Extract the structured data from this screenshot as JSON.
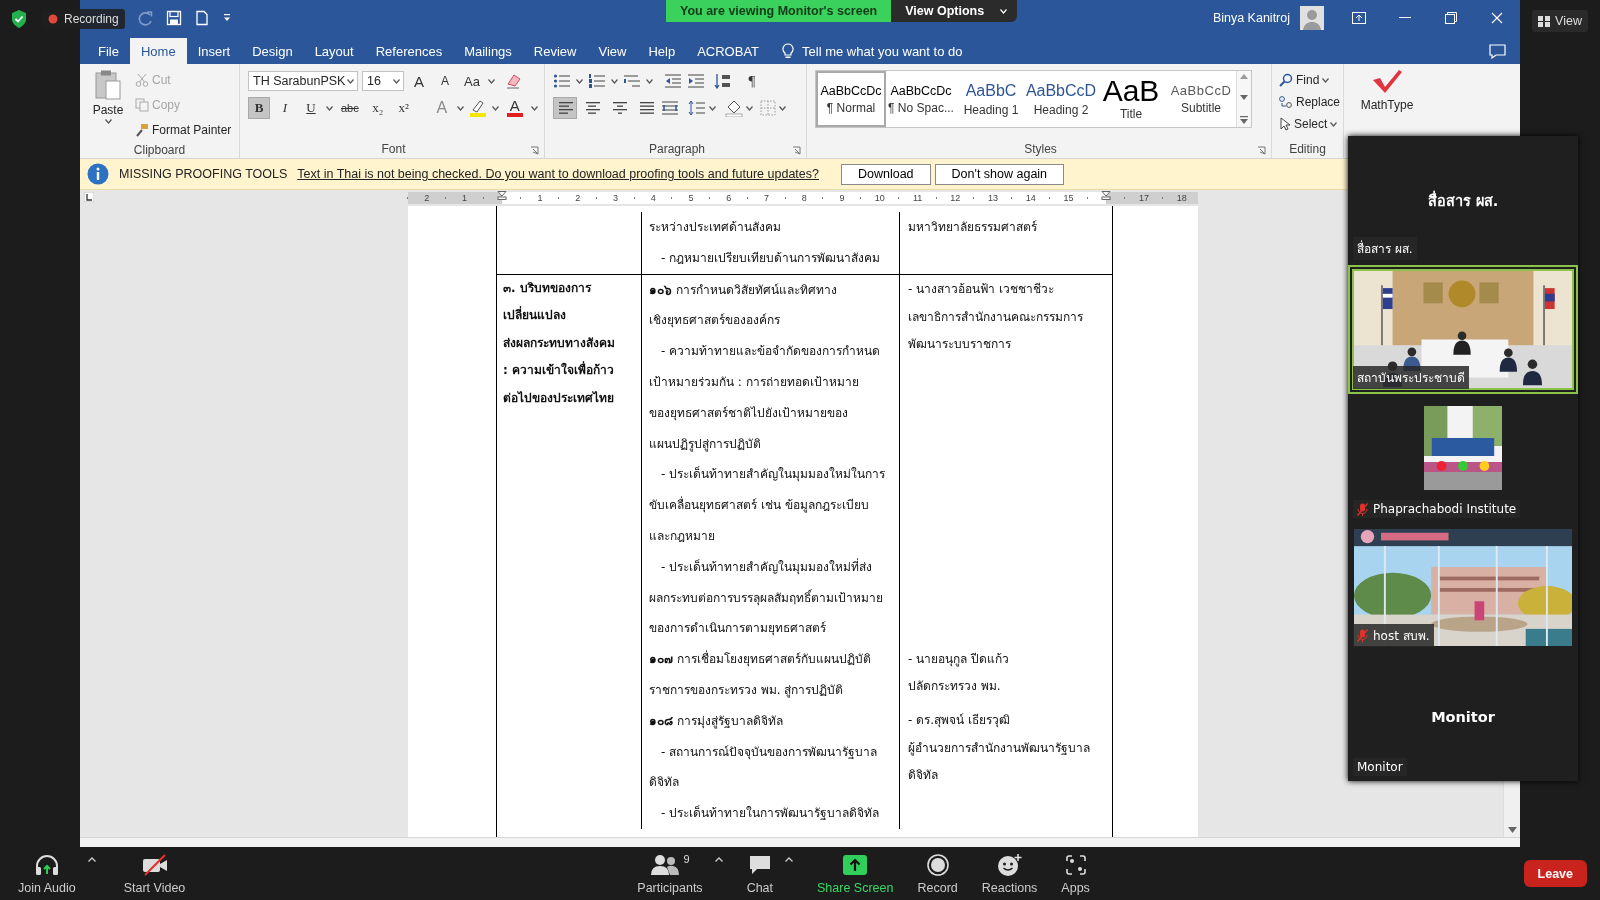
{
  "zoom_top": {
    "recording": "Recording",
    "view": "View"
  },
  "share_banner": {
    "text": "You are viewing Monitor's screen",
    "options": "View Options"
  },
  "word": {
    "user": "Binya Kanitroj",
    "tabs": [
      {
        "label": "File",
        "selected": false
      },
      {
        "label": "Home",
        "selected": true
      },
      {
        "label": "Insert",
        "selected": false
      },
      {
        "label": "Design",
        "selected": false
      },
      {
        "label": "Layout",
        "selected": false
      },
      {
        "label": "References",
        "selected": false
      },
      {
        "label": "Mailings",
        "selected": false
      },
      {
        "label": "Review",
        "selected": false
      },
      {
        "label": "View",
        "selected": false
      },
      {
        "label": "Help",
        "selected": false
      },
      {
        "label": "ACROBAT",
        "selected": false
      }
    ],
    "tell_me": "Tell me what you want to do",
    "ribbon": {
      "clipboard": {
        "label": "Clipboard",
        "paste": "Paste",
        "cut": "Cut",
        "copy": "Copy",
        "format_painter": "Format Painter"
      },
      "font": {
        "label": "Font",
        "name": "TH SarabunPSK",
        "size": "16",
        "tools": [
          {
            "kind": "grow",
            "glyph": "A"
          },
          {
            "kind": "shrink",
            "glyph": "A"
          },
          {
            "kind": "case",
            "glyph": "Aa"
          }
        ],
        "format_buttons": [
          {
            "kind": "bold",
            "glyph": "B",
            "pressed": true
          },
          {
            "kind": "italic",
            "glyph": "I",
            "pressed": false
          },
          {
            "kind": "underline",
            "glyph": "U",
            "pressed": false
          },
          {
            "kind": "strike",
            "glyph": "abc",
            "pressed": false
          },
          {
            "kind": "subscript",
            "glyph": "x₂",
            "pressed": false
          },
          {
            "kind": "superscript",
            "glyph": "x²",
            "pressed": false
          }
        ],
        "effects_glyph": "A",
        "color_glyph": "A"
      },
      "paragraph": {
        "label": "Paragraph",
        "marks_glyph": "¶",
        "align_buttons": [
          {
            "kind": "left",
            "pressed": true
          },
          {
            "kind": "center",
            "pressed": false
          },
          {
            "kind": "right",
            "pressed": false
          },
          {
            "kind": "justify",
            "pressed": false
          }
        ]
      },
      "styles": {
        "label": "Styles",
        "items": [
          {
            "kind": "normal",
            "preview": "AaBbCcDc",
            "name": "¶ Normal",
            "selected": true
          },
          {
            "kind": "normal",
            "preview": "AaBbCcDc",
            "name": "¶ No Spac...",
            "selected": false
          },
          {
            "kind": "heading",
            "preview": "AaBbC",
            "name": "Heading 1",
            "selected": false
          },
          {
            "kind": "heading",
            "preview": "AaBbCcD",
            "name": "Heading 2",
            "selected": false
          },
          {
            "kind": "title",
            "preview": "AaB",
            "name": "Title",
            "selected": false
          },
          {
            "kind": "subtitle",
            "preview": "AaBbCcD",
            "name": "Subtitle",
            "selected": false
          }
        ]
      },
      "editing": {
        "label": "Editing",
        "find": "Find",
        "replace": "Replace",
        "select": "Select"
      },
      "mathtype": "MathType"
    },
    "message_bar": {
      "title": "MISSING PROOFING TOOLS",
      "text": "Text in Thai is not being checked. Do you want to download proofing tools and future updates?",
      "buttons": [
        "Download",
        "Don't show again"
      ]
    },
    "ruler": [
      {
        "kind": "number",
        "label": "2"
      },
      {
        "kind": "number",
        "label": "1"
      },
      {
        "kind": "marker"
      },
      {
        "kind": "number",
        "label": "1"
      },
      {
        "kind": "number",
        "label": "2"
      },
      {
        "kind": "number",
        "label": "3"
      },
      {
        "kind": "number",
        "label": "4"
      },
      {
        "kind": "number",
        "label": "5"
      },
      {
        "kind": "number",
        "label": "6"
      },
      {
        "kind": "number",
        "label": "7"
      },
      {
        "kind": "number",
        "label": "8"
      },
      {
        "kind": "number",
        "label": "9"
      },
      {
        "kind": "number",
        "label": "10"
      },
      {
        "kind": "number",
        "label": "11"
      },
      {
        "kind": "number",
        "label": "12"
      },
      {
        "kind": "number",
        "label": "13"
      },
      {
        "kind": "number",
        "label": "14"
      },
      {
        "kind": "number",
        "label": "15"
      },
      {
        "kind": "marker"
      },
      {
        "kind": "number",
        "label": "17"
      },
      {
        "kind": "number",
        "label": "18"
      }
    ],
    "table": {
      "rows": [
        {
          "sections": [
            {
              "topics": [
                {
                  "indent": false,
                  "lines": [
                    "ระหว่างประเทศด้านสังคม"
                  ]
                },
                {
                  "indent": true,
                  "lines": [
                    "- กฎหมายเปรียบเทียบด้านการพัฒนาสังคม"
                  ]
                }
              ],
              "speakers": [
                {
                  "lines": [
                    "มหาวิทยาลัยธรรมศาสตร์"
                  ]
                }
              ]
            }
          ]
        },
        {
          "heading": [
            "๓. บริบทของการ",
            "เปลี่ยนแปลง",
            "ส่งผลกระทบทางสังคม",
            ": ความเข้าใจเพื่อก้าว",
            "ต่อไปของประเทศไทย"
          ],
          "sections": [
            {
              "topics": [
                {
                  "indent": false,
                  "lines": [
                    "**๑๐๖** การกำหนดวิสัยทัศน์และทิศทาง",
                    "เชิงยุทธศาสตร์ขององค์กร"
                  ]
                },
                {
                  "indent": true,
                  "lines": [
                    "- ความท้าทายและข้อจำกัดของการกำหนด",
                    "เป้าหมายร่วมกัน : การถ่ายทอดเป้าหมาย",
                    "ของยุทธศาสตร์ชาติไปยังเป้าหมายของ",
                    "แผนปฏิรูปสู่การปฏิบัติ"
                  ]
                },
                {
                  "indent": true,
                  "lines": [
                    "- ประเด็นท้าทายสำคัญในมุมมองใหม่ในการ",
                    "ขับเคลื่อนยุทธศาสตร์ เช่น ข้อมูลกฎระเบียบ",
                    "และกฎหมาย"
                  ]
                },
                {
                  "indent": true,
                  "lines": [
                    "- ประเด็นท้าทายสำคัญในมุมมองใหม่ที่ส่ง",
                    "ผลกระทบต่อการบรรลุผลสัมฤทธิ์ตามเป้าหมาย",
                    "ของการดำเนินการตามยุทธศาสตร์"
                  ]
                }
              ],
              "speakers": [
                {
                  "lines": [
                    "- นางสาวอ้อนฟ้า เวชชาชีวะ",
                    "เลขาธิการสำนักงานคณะกรรมการ",
                    "พัฒนาระบบราชการ"
                  ]
                }
              ]
            },
            {
              "topics": [
                {
                  "indent": false,
                  "lines": [
                    "**๑๐๗** การเชื่อมโยงยุทธศาสตร์กับแผนปฏิบัติ",
                    "ราชการของกระทรวง พม. สู่การปฏิบัติ"
                  ]
                }
              ],
              "speakers": [
                {
                  "lines": [
                    "- นายอนุกูล ปีดแก้ว",
                    "ปลัดกระทรวง พม."
                  ]
                }
              ]
            },
            {
              "topics": [
                {
                  "indent": false,
                  "lines": [
                    "**๑๐๘** การมุ่งสู่รัฐบาลดิจิทัล"
                  ]
                },
                {
                  "indent": true,
                  "lines": [
                    "- สถานการณ์ปัจจุบันของการพัฒนารัฐบาล",
                    "ดิจิทัล"
                  ]
                },
                {
                  "indent": true,
                  "lines": [
                    "- ประเด็นท้าทายในการพัฒนารัฐบาลดิจิทัล"
                  ]
                }
              ],
              "speakers": [
                {
                  "lines": [
                    "- ดร.สุพจน์ เธียรวุฒิ",
                    "ผู้อำนวยการสำนักงานพัฒนารัฐบาล",
                    "ดิจิทัล"
                  ]
                }
              ]
            }
          ]
        }
      ]
    }
  },
  "gallery": [
    {
      "kind": "name",
      "name": "สื่อสาร ผส.",
      "label": "สื่อสาร ผส.",
      "muted": false,
      "speaking": false
    },
    {
      "kind": "video",
      "label": "สถาบันพระประชาบดี",
      "muted": false,
      "speaking": true
    },
    {
      "kind": "thumbnail",
      "label": "Phaprachabodi Institute",
      "muted": true,
      "speaking": false
    },
    {
      "kind": "video",
      "label": "host สบพ.",
      "muted": true,
      "speaking": false
    },
    {
      "kind": "name",
      "name": "Monitor",
      "label": "Monitor",
      "muted": false,
      "speaking": false
    }
  ],
  "toolbar": {
    "items": [
      {
        "kind": "audio",
        "label": "Join Audio",
        "caret": true
      },
      {
        "kind": "video",
        "label": "Start Video",
        "caret": false
      },
      {
        "kind": "participants",
        "label": "Participants",
        "count": "9",
        "caret": true
      },
      {
        "kind": "chat",
        "label": "Chat",
        "caret": true
      },
      {
        "kind": "share",
        "label": "Share Screen",
        "caret": false
      },
      {
        "kind": "record",
        "label": "Record",
        "caret": false
      },
      {
        "kind": "reactions",
        "label": "Reactions",
        "caret": false
      },
      {
        "kind": "apps",
        "label": "Apps",
        "caret": false
      }
    ],
    "leave": "Leave"
  }
}
